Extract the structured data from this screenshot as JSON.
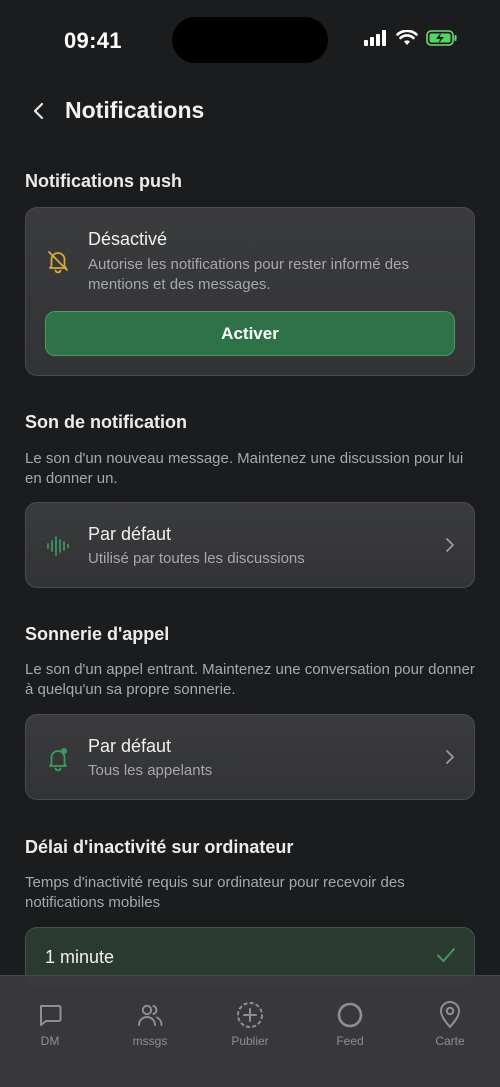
{
  "status_bar": {
    "time": "09:41"
  },
  "nav": {
    "title": "Notifications"
  },
  "push": {
    "section_title": "Notifications push",
    "status_title": "Désactivé",
    "status_desc": "Autorise les notifications pour rester informé des mentions et des messages.",
    "activate_label": "Activer"
  },
  "sound": {
    "section_title": "Son de notification",
    "section_desc": "Le son d'un nouveau message. Maintenez une discussion pour lui en donner un.",
    "item_title": "Par défaut",
    "item_sub": "Utilisé par toutes les discussions"
  },
  "ringtone": {
    "section_title": "Sonnerie d'appel",
    "section_desc": "Le son d'un appel entrant. Maintenez une conversation pour donner à quelqu'un sa propre sonnerie.",
    "item_title": "Par défaut",
    "item_sub": "Tous les appelants"
  },
  "idle": {
    "section_title": "Délai d'inactivité sur ordinateur",
    "section_desc": "Temps d'inactivité requis sur ordinateur pour recevoir des notifications mobiles",
    "selected_option": "1 minute"
  },
  "tabs": [
    {
      "label": "DM",
      "icon": "chat-bubble-icon"
    },
    {
      "label": "mssgs",
      "icon": "people-icon"
    },
    {
      "label": "Publier",
      "icon": "plus-circle-icon"
    },
    {
      "label": "Feed",
      "icon": "circle-icon"
    },
    {
      "label": "Carte",
      "icon": "map-pin-icon"
    }
  ],
  "colors": {
    "background": "#1b1c1e",
    "accent_green": "#2f7247",
    "warning_yellow": "#d9a93a",
    "icon_green": "#3f9a5e"
  }
}
